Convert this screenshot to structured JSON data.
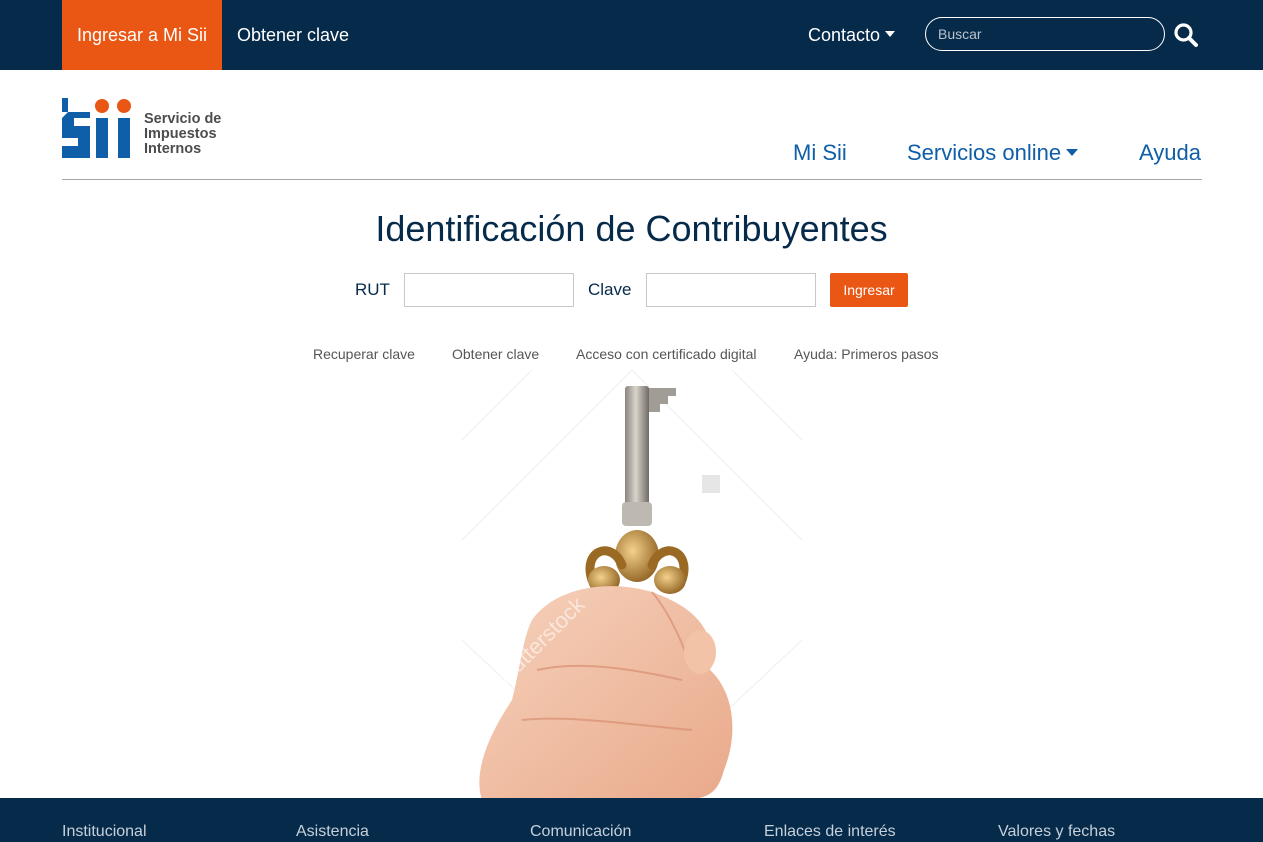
{
  "topbar": {
    "login_label": "Ingresar a Mi Sii",
    "obtener_label": "Obtener clave",
    "contacto_label": "Contacto",
    "search_placeholder": "Buscar"
  },
  "header": {
    "logo_line1": "Servicio de",
    "logo_line2": "Impuestos",
    "logo_line3": "Internos",
    "nav": {
      "misii": "Mi Sii",
      "servicios": "Servicios online",
      "ayuda": "Ayuda"
    }
  },
  "main": {
    "title": "Identificación de Contribuyentes",
    "rut_label": "RUT",
    "clave_label": "Clave",
    "rut_value": "",
    "clave_value": "",
    "submit_label": "Ingresar",
    "links": [
      "Recuperar clave",
      "Obtener clave",
      "Acceso con certificado digital",
      "Ayuda: Primeros pasos"
    ]
  },
  "footer": {
    "columns": [
      "Institucional",
      "Asistencia",
      "Comunicación",
      "Enlaces de interés",
      "Valores y fechas"
    ]
  },
  "colors": {
    "navy": "#062a4a",
    "orange": "#ea5614",
    "brand_blue": "#0f5ea8"
  }
}
